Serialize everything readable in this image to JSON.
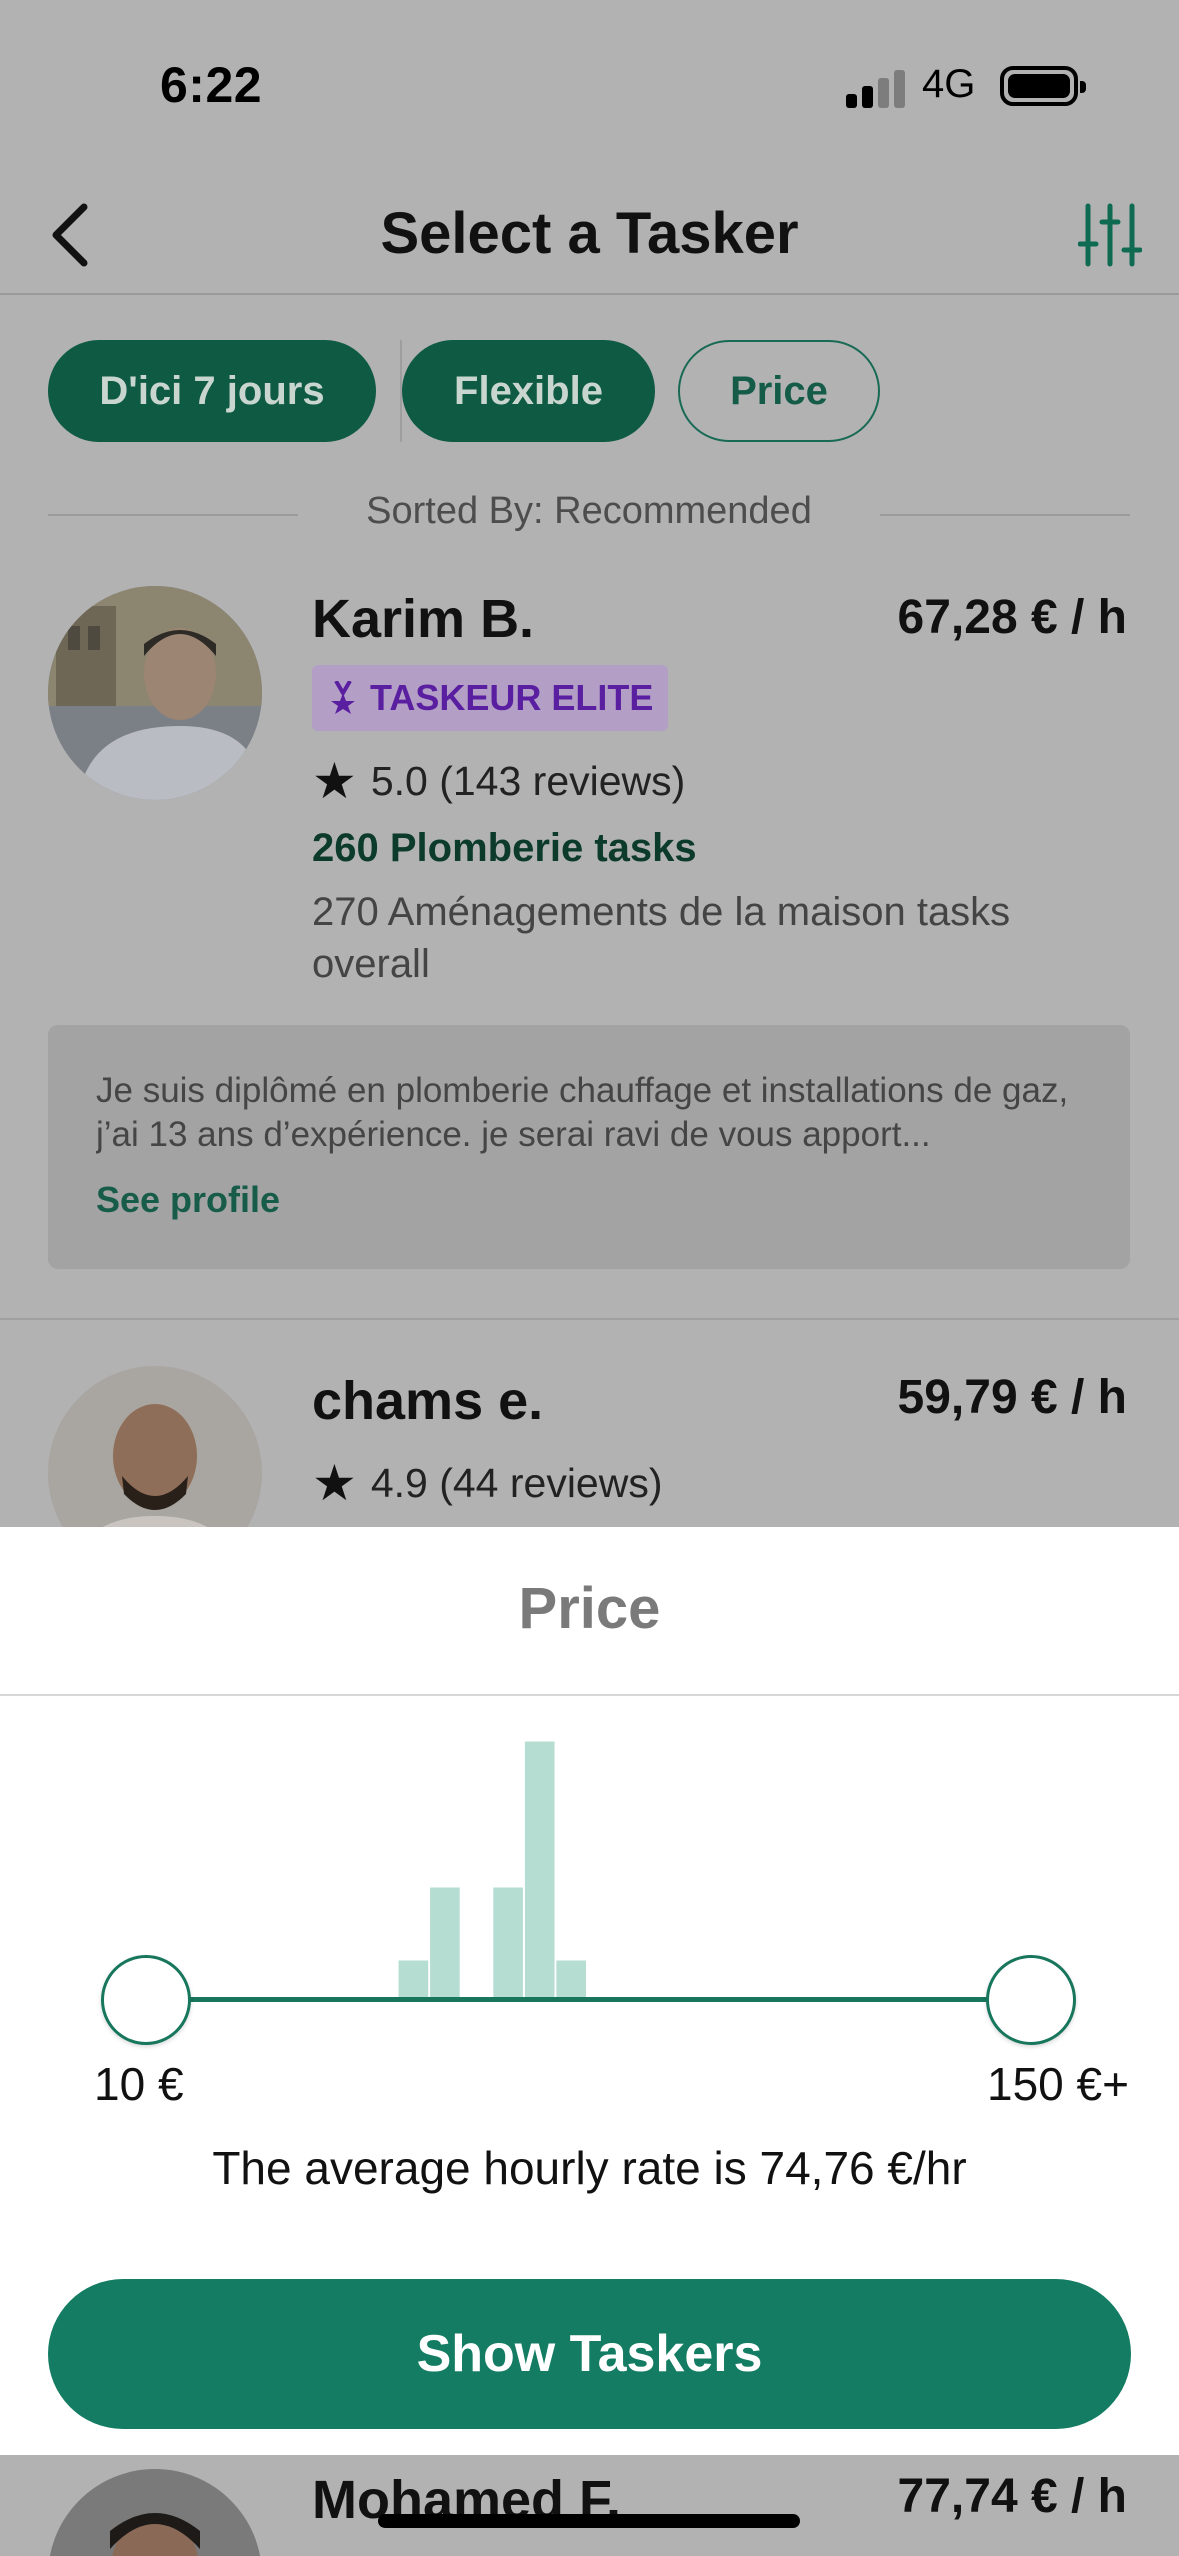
{
  "status_bar": {
    "time": "6:22",
    "network": "4G"
  },
  "header": {
    "title": "Select a Tasker"
  },
  "chips": [
    {
      "label": "D'ici 7 jours",
      "style": "filled"
    },
    {
      "label": "Flexible",
      "style": "filled"
    },
    {
      "label": "Price",
      "style": "outline"
    }
  ],
  "sort": {
    "label": "Sorted By: Recommended"
  },
  "taskers": [
    {
      "name": "Karim B.",
      "price": "67,28 € / h",
      "badge": "TASKEUR ELITE",
      "rating": "5.0 (143 reviews)",
      "category_tasks": "260 Plomberie tasks",
      "overall_tasks": "270 Aménagements de la maison tasks overall",
      "bio": "Je suis diplômé en plomberie chauffage et installations de gaz, j’ai 13 ans d’expérience. je serai ravi de vous apport...",
      "see_profile": "See profile"
    },
    {
      "name": "chams e.",
      "price": "59,79 € / h",
      "rating": "4.9 (44 reviews)"
    },
    {
      "name": "Mohamed F.",
      "price": "77,74 € / h"
    }
  ],
  "price_sheet": {
    "title": "Price",
    "min_label": "10 €",
    "max_label": "150 €+",
    "average_text": "The average hourly rate is 74,76 €/hr",
    "button_label": "Show Taskers",
    "selected_range": {
      "min": 10,
      "max": 150
    }
  },
  "chart_data": {
    "type": "bar",
    "title": "",
    "xlabel": "",
    "ylabel": "",
    "x_range": [
      10,
      150
    ],
    "bins": [
      {
        "from": 50,
        "to": 55,
        "count": 1
      },
      {
        "from": 55,
        "to": 60,
        "count": 3
      },
      {
        "from": 60,
        "to": 65,
        "count": 0
      },
      {
        "from": 65,
        "to": 70,
        "count": 3
      },
      {
        "from": 70,
        "to": 75,
        "count": 7
      },
      {
        "from": 75,
        "to": 80,
        "count": 1
      }
    ]
  },
  "colors": {
    "brand_green": "#137c62",
    "chip_green": "#0e5a43",
    "histogram_bar": "#b5ddd2",
    "elite_purple": "#5a1fa0"
  }
}
